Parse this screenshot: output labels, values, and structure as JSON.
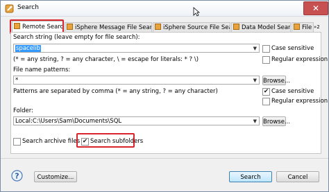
{
  "window": {
    "title": "Search"
  },
  "tabs": [
    {
      "label": "Remote Search",
      "active": true
    },
    {
      "label": "iSphere Message File Search",
      "active": false
    },
    {
      "label": "iSphere Source File Search",
      "active": false
    },
    {
      "label": "Data Model Search",
      "active": false
    },
    {
      "label": "File S",
      "active": false
    }
  ],
  "tab_overflow": "»2",
  "form": {
    "search_string_label": "Search string (leave empty for file search):",
    "search_string_value": "spacelib",
    "wildcard_hint": "(* = any string, ? = any character, \\ = escape for literals: * ? \\)",
    "case_sensitive_label": "Case sensitive",
    "regex_label": "Regular expression",
    "file_patterns_label": "File name patterns:",
    "file_patterns_value": "*",
    "browse_label": "Browse...",
    "patterns_hint": "Patterns are separated by comma (* = any string, ? = any character)",
    "case_sensitive_2_label": "Case sensitive",
    "regex_2_label": "Regular expression",
    "folder_label": "Folder:",
    "folder_value": "Local:C:\\Users\\Sam\\Documents\\SQL",
    "browse_2_label": "Browse...",
    "search_archive_label": "Search archive files",
    "search_subfolders_label": "Search subfolders"
  },
  "checks": {
    "case_sensitive": "",
    "regex": "",
    "case_sensitive_2": "✔",
    "regex_2": "",
    "search_archive": "",
    "search_subfolders": "✔"
  },
  "footer": {
    "customize_label": "Customize...",
    "search_label": "Search",
    "cancel_label": "Cancel"
  },
  "icons": {
    "app": "search-flashlight-icon",
    "close": "close-icon",
    "help": "help-icon",
    "tab": "search-tab-icon"
  },
  "colors": {
    "highlight": "#d9232d",
    "selection": "#3399ff",
    "close": "#c75050",
    "default_button": "#3c7fb1"
  }
}
